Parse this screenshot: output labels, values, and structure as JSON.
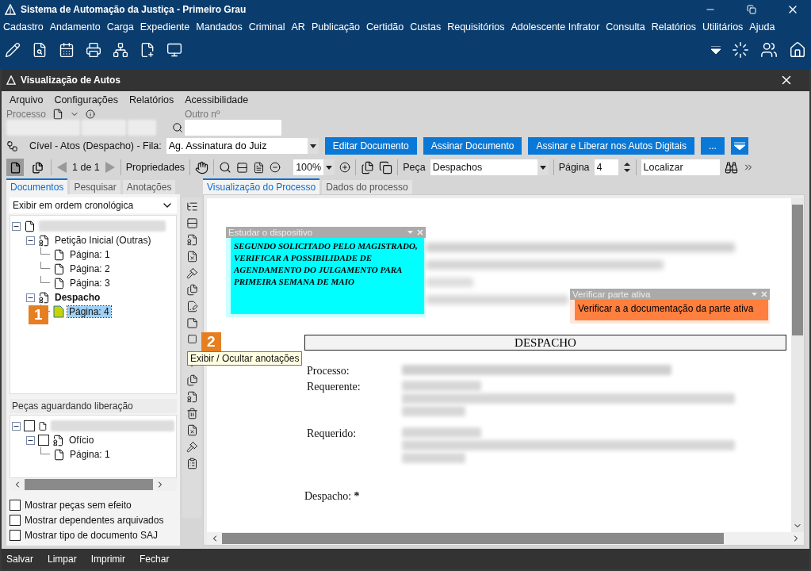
{
  "app": {
    "title": "Sistema de Automação da Justiça - Primeiro Grau"
  },
  "main_menu": [
    "Cadastro",
    "Andamento",
    "Carga",
    "Expediente",
    "Mandados",
    "Criminal",
    "AR",
    "Publicação",
    "Certidão",
    "Custas",
    "Requisitórios",
    "Adolescente Infrator",
    "Consulta",
    "Relatórios",
    "Utilitários",
    "Ajuda"
  ],
  "window": {
    "title": "Visualização de Autos"
  },
  "menu": [
    "Arquivo",
    "Configurações",
    "Relatórios",
    "Acessibilidade"
  ],
  "process": {
    "label": "Processo",
    "other_label": "Outro nº"
  },
  "workflow": {
    "label": "Cível - Atos (Despacho) - Fila:",
    "queue": "Ag. Assinatura do Juiz",
    "buttons": [
      "Editar Documento",
      "Assinar Documento",
      "Assinar e Liberar nos Autos Digitais",
      "..."
    ]
  },
  "toolbar": {
    "view_buttons": [
      {
        "selected": true
      },
      {
        "selected": false
      }
    ],
    "pager": "1 de 1",
    "properties": "Propriedades",
    "zoom": "100%",
    "piece_label": "Peça",
    "piece": "Despachos",
    "page_label": "Página",
    "page": "4",
    "find": "Localizar"
  },
  "left_tabs": [
    {
      "label": "Documentos",
      "selected": true
    },
    {
      "label": "Pesquisar",
      "selected": false
    },
    {
      "label": "Anotações",
      "selected": false
    }
  ],
  "order": "Exibir em ordem cronológica",
  "tree": [
    {
      "kind": "process",
      "expanded": true,
      "selected": false,
      "children": [
        {
          "kind": "document",
          "label": "Petição Inicial (Outras)",
          "expanded": true,
          "current": false,
          "selected": false,
          "children": [
            {
              "kind": "page",
              "label": "Página: 1",
              "selected": false
            },
            {
              "kind": "page",
              "label": "Página: 2",
              "selected": false
            },
            {
              "kind": "page",
              "label": "Página: 3",
              "selected": false
            }
          ]
        },
        {
          "kind": "document",
          "label": "Despacho",
          "expanded": true,
          "current": true,
          "selected": false,
          "children": [
            {
              "kind": "annotated-page",
              "label": "Página: 4",
              "selected": true
            }
          ]
        }
      ]
    }
  ],
  "pending": {
    "title": "Peças aguardando liberação",
    "tree": [
      {
        "kind": "process",
        "checked": false,
        "expanded": true,
        "children": [
          {
            "kind": "document",
            "label": "Ofício",
            "checked": false,
            "expanded": true,
            "children": [
              {
                "kind": "page",
                "label": "Página: 1"
              }
            ]
          }
        ]
      }
    ]
  },
  "options": [
    {
      "label": "Mostrar peças sem efeito",
      "checked": false
    },
    {
      "label": "Mostrar dependentes arquivados",
      "checked": false
    },
    {
      "label": "Mostrar tipo de documento SAJ",
      "checked": false
    }
  ],
  "tooltip": "Exibir / Ocultar anotações",
  "callouts": [
    "1",
    "2"
  ],
  "viewer_tabs": [
    {
      "label": "Visualização do Processo",
      "selected": true
    },
    {
      "label": "Dados do processo",
      "selected": false
    }
  ],
  "notes": [
    {
      "title": "Estudar o dispositivo",
      "text": "SEGUNDO SOLICITADO PELO MAGISTRADO, VERIFICAR A POSSIBILIDADE DE AGENDAMENTO DO JULGAMENTO PARA PRIMEIRA SEMANA DE MAIO",
      "color": "#00ffff"
    },
    {
      "title": "Verificar parte ativa",
      "text": "Verificar a a documentação da parte ativa",
      "color": "#ff7f3f"
    }
  ],
  "document": {
    "heading": "DESPACHO",
    "fields": [
      {
        "label": "Processo:",
        "kind": "single"
      },
      {
        "label": "Requerente:",
        "kind": "address"
      },
      {
        "label": "Requerido:",
        "kind": "address"
      }
    ],
    "despacho_label": "Despacho:",
    "required_mark": "*"
  },
  "footer": [
    "Salvar",
    "Limpar",
    "Imprimir",
    "Fechar"
  ]
}
